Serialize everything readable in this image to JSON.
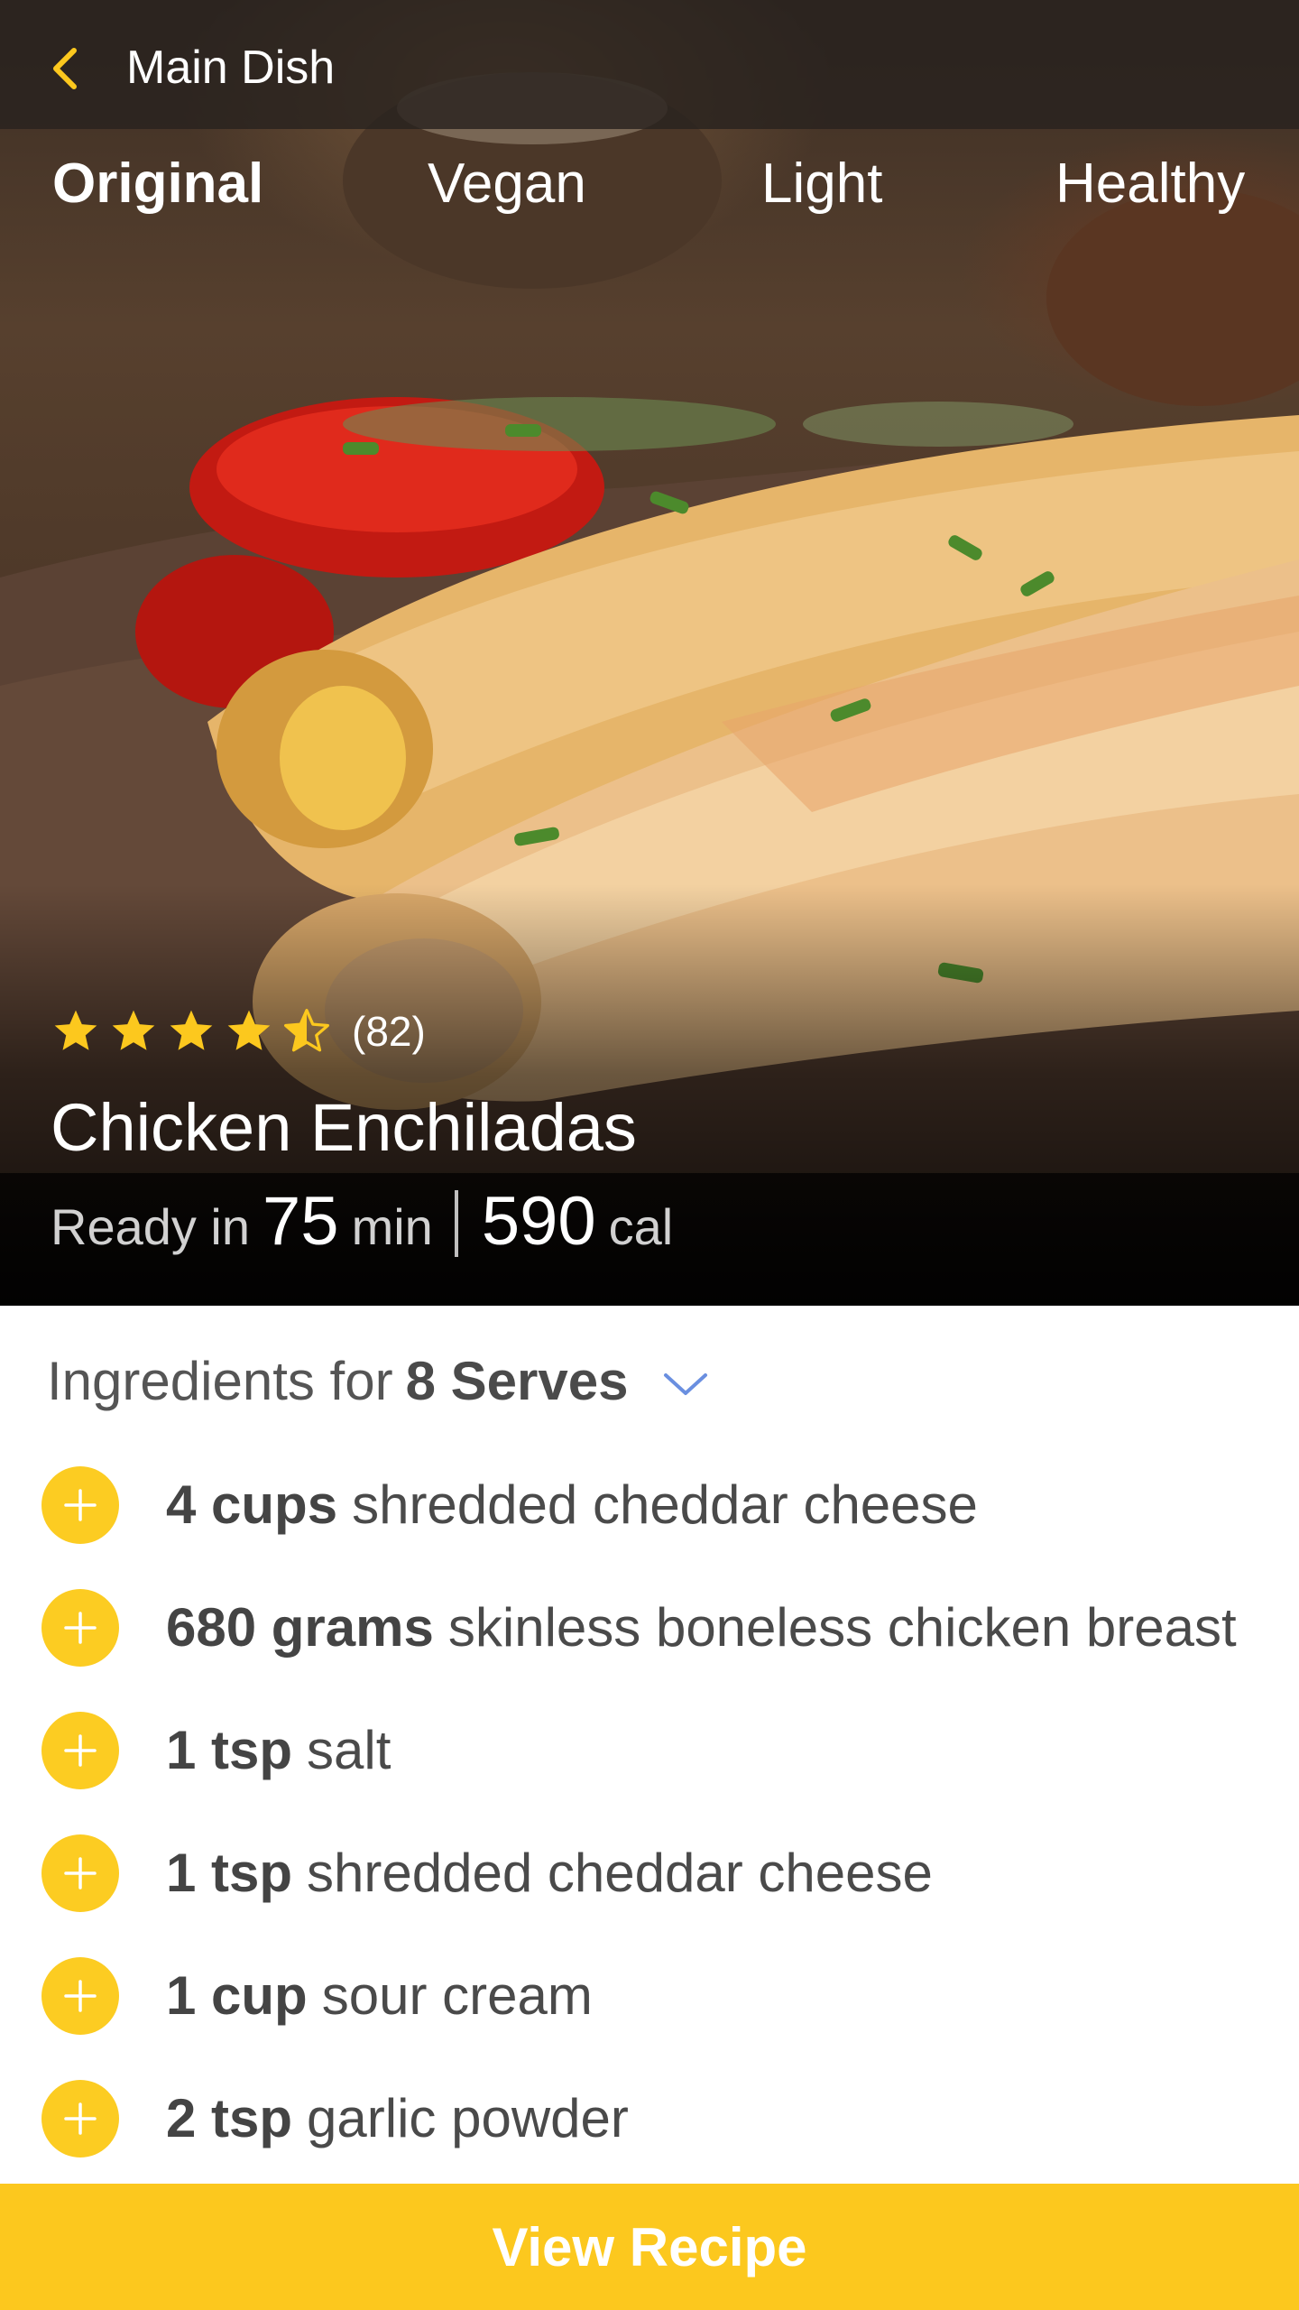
{
  "topbar": {
    "title": "Main Dish",
    "back_icon": "chevron-left-icon"
  },
  "tabs": [
    {
      "label": "Original",
      "active": true
    },
    {
      "label": "Vegan",
      "active": false
    },
    {
      "label": "Light",
      "active": false
    },
    {
      "label": "Healthy",
      "active": false
    }
  ],
  "recipe": {
    "rating": 4.5,
    "rating_count": "(82)",
    "title": "Chicken Enchiladas",
    "ready_prefix": "Ready in",
    "time_value": "75",
    "time_unit": "min",
    "calories_value": "590",
    "calories_unit": "cal"
  },
  "ingredients": {
    "header_prefix": "Ingredients for",
    "serves": "8 Serves",
    "items": [
      {
        "qty": "4 cups",
        "name": "shredded cheddar cheese"
      },
      {
        "qty": "680 grams",
        "name": "skinless boneless chicken breast"
      },
      {
        "qty": "1 tsp",
        "name": "salt"
      },
      {
        "qty": "1 tsp",
        "name": "shredded cheddar cheese"
      },
      {
        "qty": "1 cup",
        "name": "sour cream"
      },
      {
        "qty": "2 tsp",
        "name": "garlic powder"
      }
    ]
  },
  "footer": {
    "button_label": "View Recipe"
  },
  "colors": {
    "accent": "#fcc81e",
    "chevron": "#6a8fe0",
    "text_dark": "#4a4a4a"
  }
}
